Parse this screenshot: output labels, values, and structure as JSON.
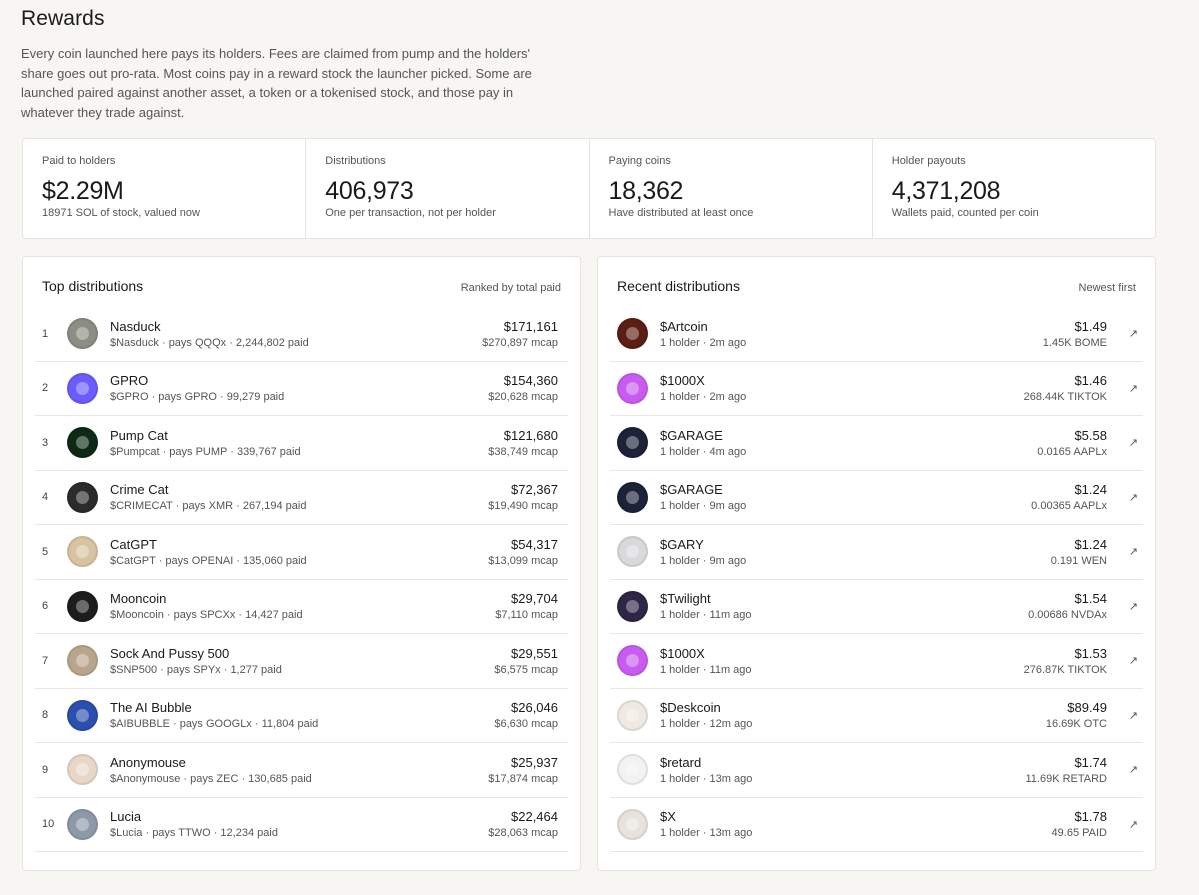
{
  "page": {
    "title": "Rewards",
    "intro": "Every coin launched here pays its holders. Fees are claimed from pump and the holders' share goes out pro-rata. Most coins pay in a reward stock the launcher picked. Some are launched paired against another asset, a token or a tokenised stock, and those pay in whatever they trade against."
  },
  "stats": [
    {
      "label": "Paid to holders",
      "value": "$2.29M",
      "sub": "18971 SOL of stock, valued now"
    },
    {
      "label": "Distributions",
      "value": "406,973",
      "sub": "One per transaction, not per holder"
    },
    {
      "label": "Paying coins",
      "value": "18,362",
      "sub": "Have distributed at least once"
    },
    {
      "label": "Holder payouts",
      "value": "4,371,208",
      "sub": "Wallets paid, counted per coin"
    }
  ],
  "top": {
    "title": "Top distributions",
    "subtitle": "Ranked by total paid",
    "rows": [
      {
        "rank": "1",
        "name": "Nasduck",
        "meta": "$Nasduck · pays QQQx · 2,244,802 paid",
        "amount": "$171,161",
        "mcap": "$270,897 mcap",
        "icon": "duck-avatar-icon",
        "color": "#8d8d84"
      },
      {
        "rank": "2",
        "name": "GPRO",
        "meta": "$GPRO · pays GPRO · 99,279 paid",
        "amount": "$154,360",
        "mcap": "$20,628 mcap",
        "icon": "gopro-logo-icon",
        "color": "#6a5cff"
      },
      {
        "rank": "3",
        "name": "Pump Cat",
        "meta": "$Pumpcat · pays PUMP · 339,767 paid",
        "amount": "$121,680",
        "mcap": "$38,749 mcap",
        "icon": "pump-cat-avatar-icon",
        "color": "#0e2a14"
      },
      {
        "rank": "4",
        "name": "Crime Cat",
        "meta": "$CRIMECAT · pays XMR · 267,194 paid",
        "amount": "$72,367",
        "mcap": "$19,490 mcap",
        "icon": "crime-cat-avatar-icon",
        "color": "#2b2b2b"
      },
      {
        "rank": "5",
        "name": "CatGPT",
        "meta": "$CatGPT · pays OPENAI · 135,060 paid",
        "amount": "$54,317",
        "mcap": "$13,099 mcap",
        "icon": "catgpt-avatar-icon",
        "color": "#d8c3a0"
      },
      {
        "rank": "6",
        "name": "Mooncoin",
        "meta": "$Mooncoin · pays SPCXx · 14,427 paid",
        "amount": "$29,704",
        "mcap": "$7,110 mcap",
        "icon": "mooncoin-logo-icon",
        "color": "#1d1d1d"
      },
      {
        "rank": "7",
        "name": "Sock And Pussy 500",
        "meta": "$SNP500 · pays SPYx · 1,277 paid",
        "amount": "$29,551",
        "mcap": "$6,575 mcap",
        "icon": "cat-avatar-icon",
        "color": "#b8a58c"
      },
      {
        "rank": "8",
        "name": "The AI Bubble",
        "meta": "$AIBUBBLE · pays GOOGLx · 11,804 paid",
        "amount": "$26,046",
        "mcap": "$6,630 mcap",
        "icon": "ai-bubble-logo-icon",
        "color": "#2a4fae"
      },
      {
        "rank": "9",
        "name": "Anonymouse",
        "meta": "$Anonymouse · pays ZEC · 130,685 paid",
        "amount": "$25,937",
        "mcap": "$17,874 mcap",
        "icon": "mouse-avatar-icon",
        "color": "#e8d7c8"
      },
      {
        "rank": "10",
        "name": "Lucia",
        "meta": "$Lucia · pays TTWO · 12,234 paid",
        "amount": "$22,464",
        "mcap": "$28,063 mcap",
        "icon": "lucia-avatar-icon",
        "color": "#8d98a8"
      }
    ]
  },
  "recent": {
    "title": "Recent distributions",
    "subtitle": "Newest first",
    "arrow": "↗",
    "rows": [
      {
        "name": "$Artcoin",
        "meta": "1 holder · 2m ago",
        "amount": "$1.49",
        "paid": "1.45K BOME",
        "icon": "artcoin-avatar-icon",
        "color": "#5a1e14"
      },
      {
        "name": "$1000X",
        "meta": "1 holder · 2m ago",
        "amount": "$1.46",
        "paid": "268.44K TIKTOK",
        "icon": "rainbow-avatar-icon",
        "color": "#c85cf0"
      },
      {
        "name": "$GARAGE",
        "meta": "1 holder · 4m ago",
        "amount": "$5.58",
        "paid": "0.0165 AAPLx",
        "icon": "garage-avatar-icon",
        "color": "#1c2238"
      },
      {
        "name": "$GARAGE",
        "meta": "1 holder · 9m ago",
        "amount": "$1.24",
        "paid": "0.00365 AAPLx",
        "icon": "garage-avatar-icon",
        "color": "#1c2238"
      },
      {
        "name": "$GARY",
        "meta": "1 holder · 9m ago",
        "amount": "$1.24",
        "paid": "0.191 WEN",
        "icon": "cat-avatar-icon",
        "color": "#d9d9dc"
      },
      {
        "name": "$Twilight",
        "meta": "1 holder · 11m ago",
        "amount": "$1.54",
        "paid": "0.00686 NVDAx",
        "icon": "twilight-avatar-icon",
        "color": "#2d2646"
      },
      {
        "name": "$1000X",
        "meta": "1 holder · 11m ago",
        "amount": "$1.53",
        "paid": "276.87K TIKTOK",
        "icon": "rainbow-avatar-icon",
        "color": "#c85cf0"
      },
      {
        "name": "$Deskcoin",
        "meta": "1 holder · 12m ago",
        "amount": "$89.49",
        "paid": "16.69K OTC",
        "icon": "desk-avatar-icon",
        "color": "#efe9e2"
      },
      {
        "name": "$retard",
        "meta": "1 holder · 13m ago",
        "amount": "$1.74",
        "paid": "11.69K RETARD",
        "icon": "text-avatar-icon",
        "color": "#f2f2f2"
      },
      {
        "name": "$X",
        "meta": "1 holder · 13m ago",
        "amount": "$1.78",
        "paid": "49.65 PAID",
        "icon": "x-avatar-icon",
        "color": "#e6e3de"
      }
    ]
  }
}
